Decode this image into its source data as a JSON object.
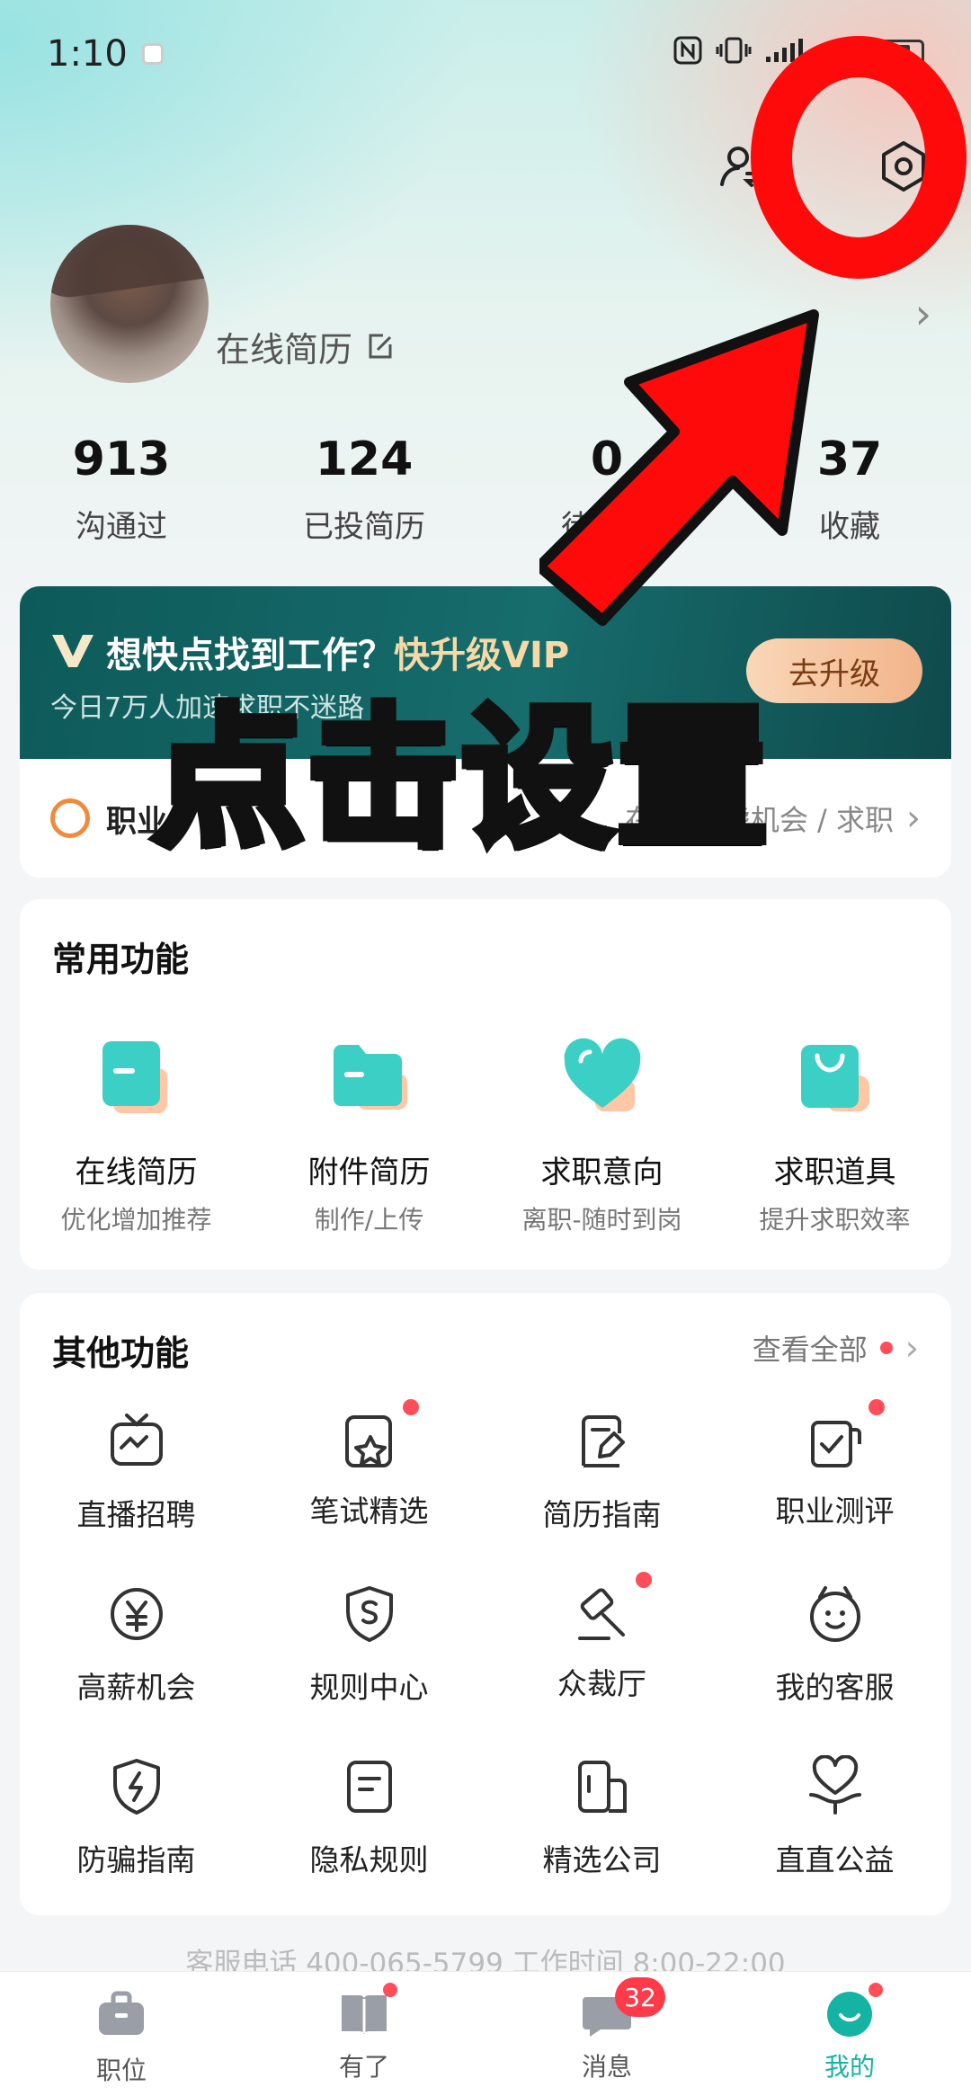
{
  "status_bar": {
    "time": "1:10"
  },
  "profile": {
    "username": "",
    "resume_link": "在线简历"
  },
  "stats": [
    {
      "value": "913",
      "label": "沟通过"
    },
    {
      "value": "124",
      "label": "已投简历"
    },
    {
      "value": "0",
      "label": "待面试"
    },
    {
      "value": "37",
      "label": "收藏"
    }
  ],
  "vip": {
    "title_prefix": "想快点找到工作？",
    "title_highlight": "快升级VIP",
    "subtitle": "今日7万人加速求职不迷路",
    "button": "去升级"
  },
  "career": {
    "title": "职业",
    "status": "在职-考虑机会 / 求职"
  },
  "overlay": {
    "text": "点击设置"
  },
  "common": {
    "title": "常用功能",
    "items": [
      {
        "label": "在线简历",
        "sub": "优化增加推荐",
        "icon": "resume-icon"
      },
      {
        "label": "附件简历",
        "sub": "制作/上传",
        "icon": "folder-icon"
      },
      {
        "label": "求职意向",
        "sub": "离职-随时到岗",
        "icon": "heart-icon"
      },
      {
        "label": "求职道具",
        "sub": "提升求职效率",
        "icon": "bag-icon"
      }
    ]
  },
  "other": {
    "title": "其他功能",
    "see_all": "查看全部",
    "items": [
      {
        "label": "直播招聘",
        "icon": "tv-icon"
      },
      {
        "label": "笔试精选",
        "icon": "star-doc-icon"
      },
      {
        "label": "简历指南",
        "icon": "pen-doc-icon"
      },
      {
        "label": "职业测评",
        "icon": "check-doc-icon"
      },
      {
        "label": "高薪机会",
        "icon": "yen-icon"
      },
      {
        "label": "规则中心",
        "icon": "shield-s-icon"
      },
      {
        "label": "众裁厅",
        "icon": "gavel-icon"
      },
      {
        "label": "我的客服",
        "icon": "service-face-icon"
      },
      {
        "label": "防骗指南",
        "icon": "shield-bolt-icon"
      },
      {
        "label": "隐私规则",
        "icon": "doc-lines-icon"
      },
      {
        "label": "精选公司",
        "icon": "building-icon"
      },
      {
        "label": "直直公益",
        "icon": "charity-heart-icon"
      }
    ]
  },
  "footer_note": "客服电话 400-065-5799  工作时间 8:00-22:00",
  "tabs": [
    {
      "label": "职位"
    },
    {
      "label": "有了"
    },
    {
      "label": "消息",
      "badge": "32"
    },
    {
      "label": "我的"
    }
  ]
}
